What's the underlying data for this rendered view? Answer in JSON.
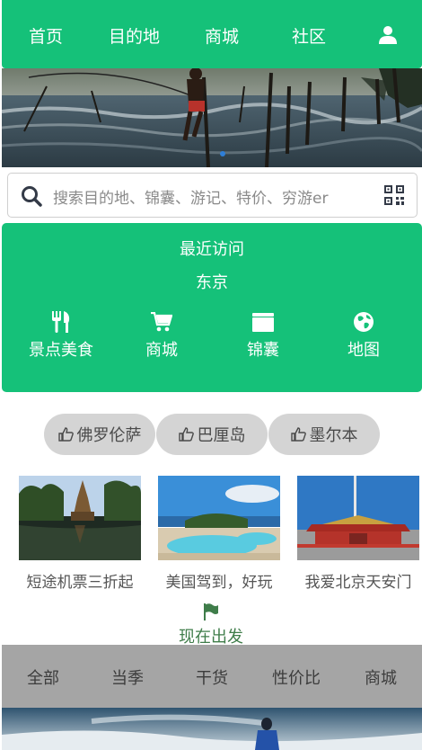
{
  "nav": {
    "home": "首页",
    "destinations": "目的地",
    "mall": "商城",
    "community": "社区"
  },
  "search": {
    "placeholder": "搜索目的地、锦囊、游记、特价、穷游er"
  },
  "recent": {
    "title": "最近访问",
    "city": "东京",
    "shortcuts": [
      {
        "label": "景点美食",
        "icon": "utensils-icon"
      },
      {
        "label": "商城",
        "icon": "cart-icon"
      },
      {
        "label": "锦囊",
        "icon": "folder-icon"
      },
      {
        "label": "地图",
        "icon": "globe-icon"
      }
    ]
  },
  "tags": [
    "佛罗伦萨",
    "巴厘岛",
    "墨尔本"
  ],
  "cards": [
    {
      "caption": "短途机票三折起"
    },
    {
      "caption": "美国驾到，好玩"
    },
    {
      "caption": "我爱北京天安门"
    }
  ],
  "go": {
    "label": "现在出发",
    "icon": "flag-icon"
  },
  "tabs": [
    "全部",
    "当季",
    "干货",
    "性价比",
    "商城"
  ],
  "colors": {
    "brand_green": "#15c179",
    "tab_bar": "#a5a5a5",
    "pill": "#d4d4d4"
  }
}
